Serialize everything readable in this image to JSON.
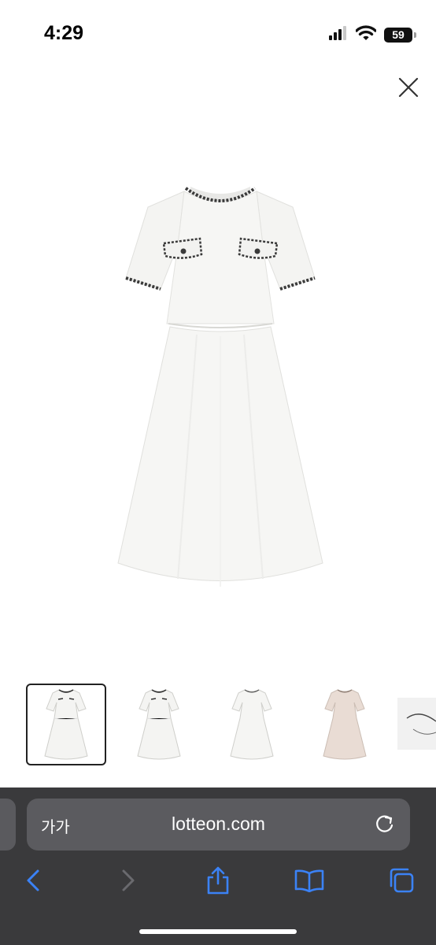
{
  "status_bar": {
    "time": "4:29",
    "battery": "59",
    "icons": [
      "cellular-signal-icon",
      "wifi-icon",
      "battery-icon"
    ]
  },
  "viewer": {
    "close_icon": "close-icon",
    "thumbnails": [
      {
        "name": "dress-front-white",
        "selected": true
      },
      {
        "name": "dress-white-alt",
        "selected": false
      },
      {
        "name": "dress-white-simple",
        "selected": false
      },
      {
        "name": "dress-beige",
        "selected": false
      },
      {
        "name": "dress-detail",
        "selected": false
      }
    ]
  },
  "browser": {
    "text_size_label": "가가",
    "url": "lotteon.com",
    "toolbar": [
      "back-icon",
      "forward-icon",
      "share-icon",
      "bookmarks-icon",
      "tabs-icon"
    ]
  },
  "colors": {
    "accent": "#3b82f6",
    "toolbar_bg": "#3a3a3c",
    "address_bar_bg": "#5b5b5f"
  }
}
